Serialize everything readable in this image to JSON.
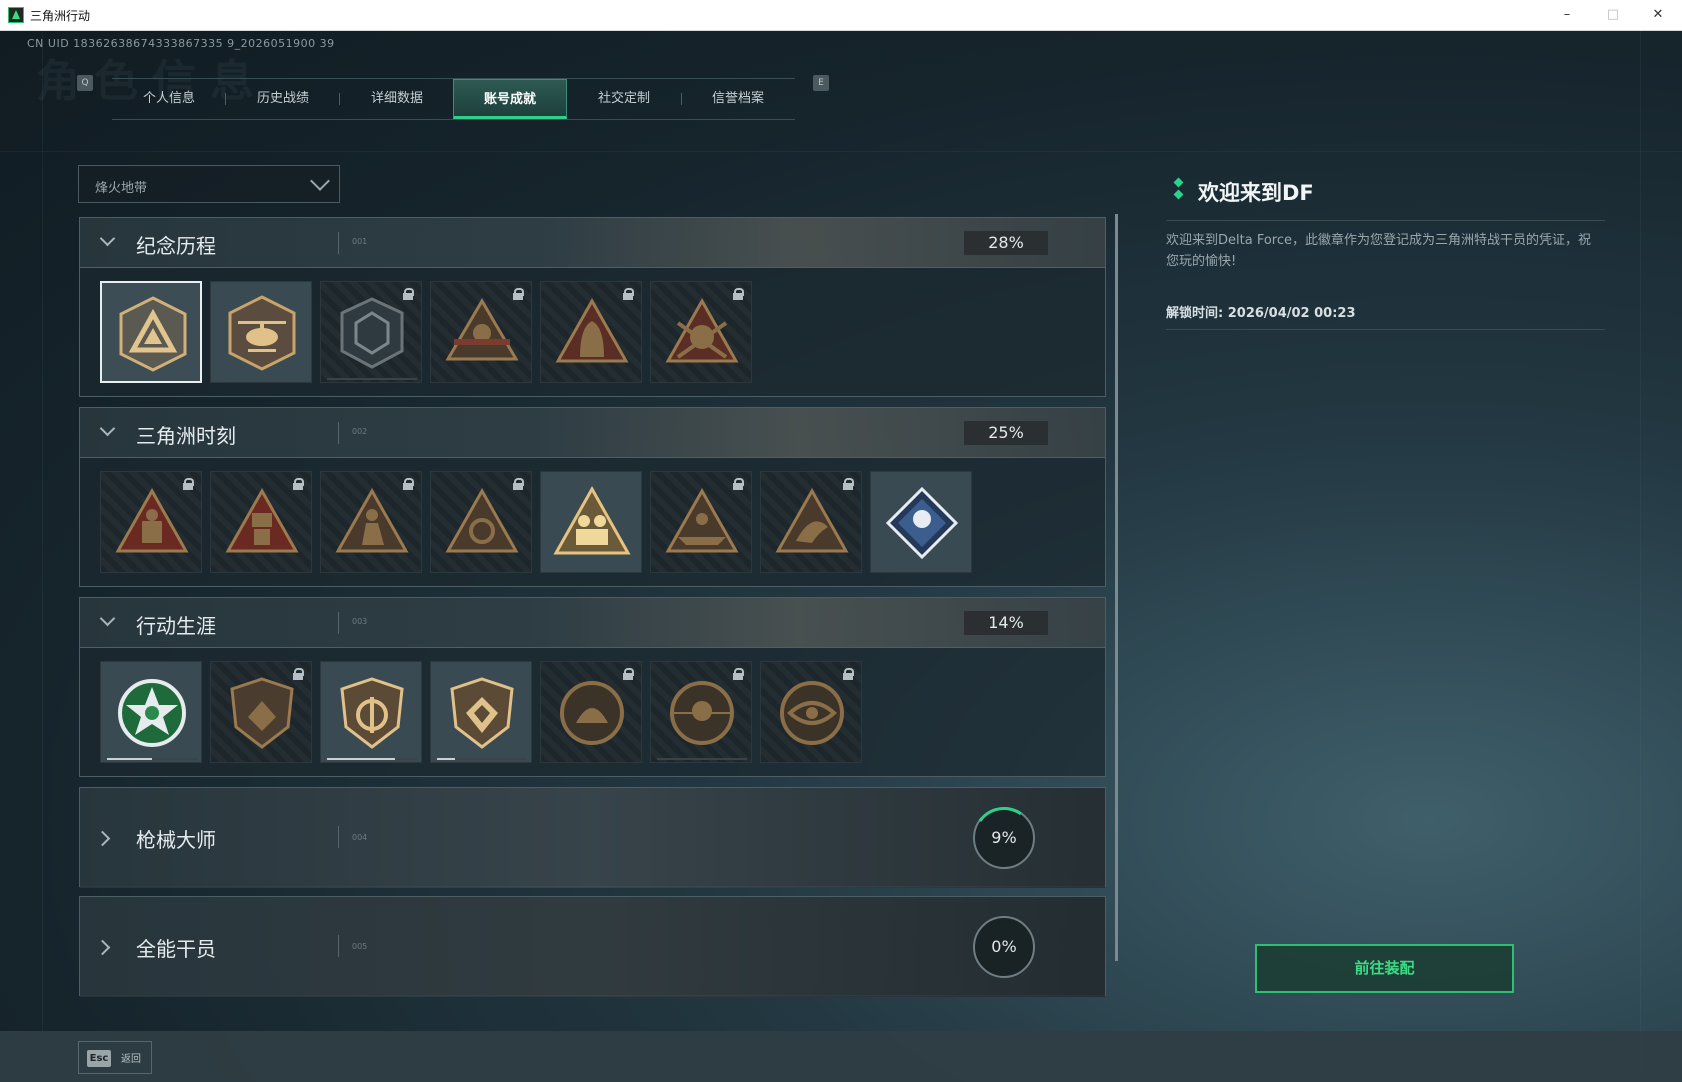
{
  "window": {
    "title": "三角洲行动",
    "min": "–",
    "max": "□",
    "close": "✕"
  },
  "uid": "CN UID 18362638674333867335 9_2026051900 39",
  "header_ghost_title": "角色信息",
  "tabs": {
    "left_key": "Q",
    "right_key": "E",
    "items": [
      {
        "label": "个人信息"
      },
      {
        "label": "历史战绩"
      },
      {
        "label": "详细数据"
      },
      {
        "label": "账号成就"
      },
      {
        "label": "社交定制"
      },
      {
        "label": "信誉档案"
      }
    ],
    "active_index": 3
  },
  "mode_dropdown": {
    "value": "烽火地带"
  },
  "sections": [
    {
      "title": "纪念历程",
      "code": "001",
      "progress": "28%",
      "expanded": true,
      "badges": [
        {
          "icon": "delta-triangle-shield-badge",
          "locked": false,
          "selected": true
        },
        {
          "icon": "helicopter-badge",
          "locked": false
        },
        {
          "icon": "dark-shield-badge",
          "locked": true
        },
        {
          "icon": "winged-soldier-badge",
          "locked": true
        },
        {
          "icon": "hooded-operator-badge",
          "locked": true
        },
        {
          "icon": "masked-operator-badge",
          "locked": true
        }
      ]
    },
    {
      "title": "三角洲时刻",
      "code": "002",
      "progress": "25%",
      "expanded": true,
      "badges": [
        {
          "icon": "red-triangle-crate-badge",
          "locked": true
        },
        {
          "icon": "red-triangle-robot-badge",
          "locked": true
        },
        {
          "icon": "triangle-kneeling-soldier-badge",
          "locked": true
        },
        {
          "icon": "triangle-gear-badge",
          "locked": true
        },
        {
          "icon": "gold-triangle-squad-badge",
          "locked": false
        },
        {
          "icon": "triangle-squad-badge",
          "locked": true
        },
        {
          "icon": "triangle-dragon-badge",
          "locked": true
        },
        {
          "icon": "blue-diamond-trophy-badge",
          "locked": false
        }
      ]
    },
    {
      "title": "行动生涯",
      "code": "003",
      "progress": "14%",
      "expanded": true,
      "badges": [
        {
          "icon": "green-star-wreath-badge",
          "locked": false,
          "bar": 0.5
        },
        {
          "icon": "shield-crest-badge",
          "locked": true
        },
        {
          "icon": "shield-arrows-badge",
          "locked": false,
          "bar": 0.75
        },
        {
          "icon": "shield-gem-badge",
          "locked": false,
          "bar": 0.2
        },
        {
          "icon": "round-helmet-badge",
          "locked": true
        },
        {
          "icon": "round-skull-badge",
          "locked": true
        },
        {
          "icon": "round-eye-badge",
          "locked": true
        }
      ]
    },
    {
      "title": "枪械大师",
      "code": "004",
      "progress": "9%",
      "expanded": false
    },
    {
      "title": "全能干员",
      "code": "005",
      "progress": "0%",
      "expanded": false
    }
  ],
  "detail_panel": {
    "title": "欢迎来到DF",
    "description": "欢迎来到Delta Force，此徽章作为您登记成为三角洲特战干员的凭证，祝您玩的愉快!",
    "unlock_time": "解锁时间: 2026/04/02 00:23",
    "equip_button": "前往装配"
  },
  "footer": {
    "esc_key": "Esc",
    "esc_label": "返回"
  },
  "colors": {
    "accent": "#2fd08a",
    "gold": "#c9a46a",
    "locked_red": "#7a3c2e"
  }
}
